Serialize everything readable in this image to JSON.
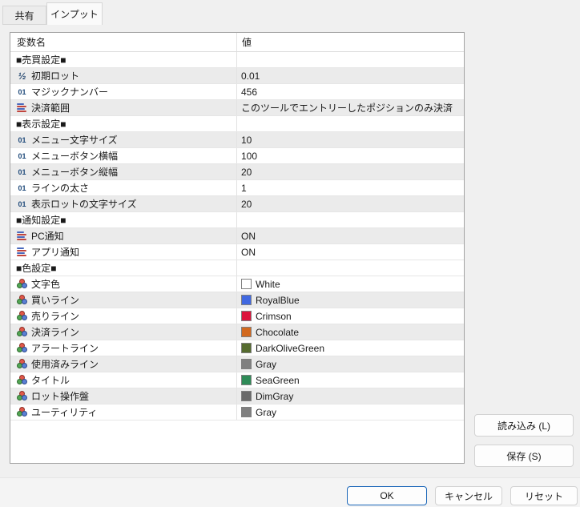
{
  "tabs": [
    {
      "label": "共有",
      "selected": false
    },
    {
      "label": "インプット",
      "selected": true
    }
  ],
  "table": {
    "headers": {
      "name": "変数名",
      "value": "値"
    },
    "rows": [
      {
        "type": "section",
        "name": "■売買設定■",
        "value": "",
        "shaded": false
      },
      {
        "type": "double",
        "name": "初期ロット",
        "value": "0.01",
        "shaded": true
      },
      {
        "type": "int",
        "name": "マジックナンバー",
        "value": "456",
        "shaded": false
      },
      {
        "type": "enum",
        "name": "決済範囲",
        "value": "このツールでエントリーしたポジションのみ決済",
        "shaded": true
      },
      {
        "type": "section",
        "name": "■表示設定■",
        "value": "",
        "shaded": false
      },
      {
        "type": "int",
        "name": "メニュー文字サイズ",
        "value": "10",
        "shaded": true
      },
      {
        "type": "int",
        "name": "メニューボタン横幅",
        "value": "100",
        "shaded": false
      },
      {
        "type": "int",
        "name": "メニューボタン縦幅",
        "value": "20",
        "shaded": true
      },
      {
        "type": "int",
        "name": "ラインの太さ",
        "value": "1",
        "shaded": false
      },
      {
        "type": "int",
        "name": "表示ロットの文字サイズ",
        "value": "20",
        "shaded": true
      },
      {
        "type": "section",
        "name": "■通知設定■",
        "value": "",
        "shaded": false
      },
      {
        "type": "enum",
        "name": "PC通知",
        "value": "ON",
        "shaded": true
      },
      {
        "type": "enum",
        "name": "アプリ通知",
        "value": "ON",
        "shaded": false
      },
      {
        "type": "section",
        "name": "■色設定■",
        "value": "",
        "shaded": false
      },
      {
        "type": "color",
        "name": "文字色",
        "value": "White",
        "swatch": "#FFFFFF",
        "shaded": false
      },
      {
        "type": "color",
        "name": "買いライン",
        "value": "RoyalBlue",
        "swatch": "#4169E1",
        "shaded": true
      },
      {
        "type": "color",
        "name": "売りライン",
        "value": "Crimson",
        "swatch": "#DC143C",
        "shaded": false
      },
      {
        "type": "color",
        "name": "決済ライン",
        "value": "Chocolate",
        "swatch": "#D2691E",
        "shaded": true
      },
      {
        "type": "color",
        "name": "アラートライン",
        "value": "DarkOliveGreen",
        "swatch": "#556B2F",
        "shaded": false
      },
      {
        "type": "color",
        "name": "使用済みライン",
        "value": "Gray",
        "swatch": "#808080",
        "shaded": true
      },
      {
        "type": "color",
        "name": "タイトル",
        "value": "SeaGreen",
        "swatch": "#2E8B57",
        "shaded": false
      },
      {
        "type": "color",
        "name": "ロット操作盤",
        "value": "DimGray",
        "swatch": "#696969",
        "shaded": true
      },
      {
        "type": "color",
        "name": "ユーティリティ",
        "value": "Gray",
        "swatch": "#808080",
        "shaded": false
      }
    ]
  },
  "side_buttons": [
    {
      "label": "読み込み (L)"
    },
    {
      "label": "保存 (S)"
    }
  ],
  "footer_buttons": [
    {
      "label": "OK",
      "default": true
    },
    {
      "label": "キャンセル",
      "default": false
    },
    {
      "label": "リセット",
      "default": false
    }
  ],
  "colors": {
    "dialog_bg": "#f0f0f0",
    "shaded_row_bg": "#ebebeb",
    "table_border": "#a3a3a3",
    "grid_line": "#e6e6e6",
    "ok_button_border": "#1a66b8",
    "swatch_border": "#808080"
  }
}
